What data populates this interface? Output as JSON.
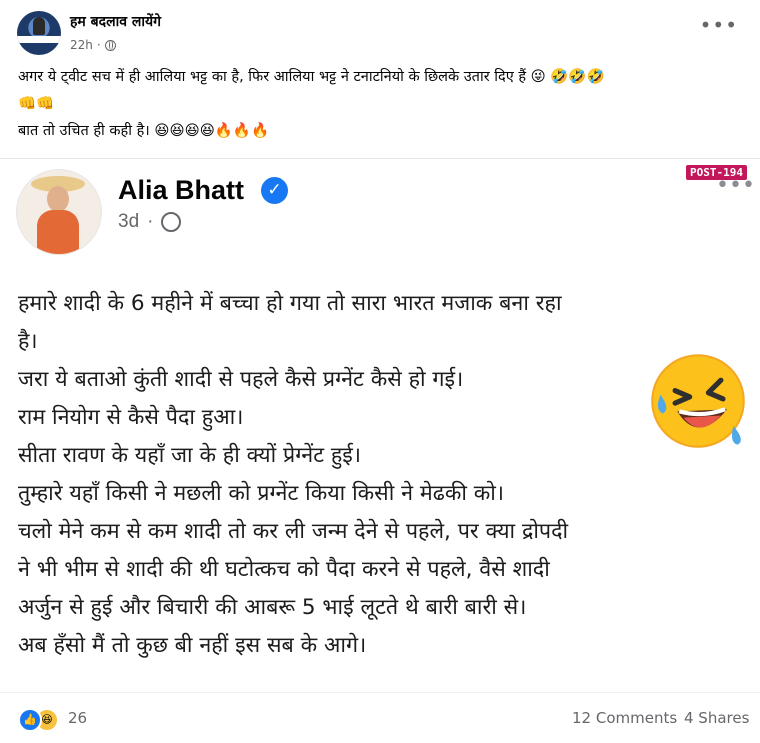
{
  "post": {
    "page_name": "हम बदलाव लायेंगे",
    "time": "22h",
    "caption_line1": "अगर ये ट्वीट सच में ही आलिया भट्ट का है, फिर आलिया भट्ट ने टनाटनियो के छिलके उतार दिए हैं  😜 🤣🤣🤣",
    "caption_line2": "👊👊",
    "caption_line3": "बात तो उचित ही कही है।  😆😆😆😆🔥🔥🔥"
  },
  "shared": {
    "author": "Alia Bhatt",
    "time": "3d",
    "badge": "POST-194",
    "lines": [
      "हमारे शादी के 6 महीने में बच्चा हो गया तो सारा भारत मजाक बना रहा",
      "है।",
      "जरा ये बताओ कुंती शादी से पहले कैसे प्रग्नेंट कैसे हो गई।",
      "राम नियोग से कैसे पैदा हुआ।",
      "सीता रावण के यहाँ जा के ही क्यों प्रेग्नेंट हुई।",
      "तुम्हारे यहाँ किसी ने मछली को प्रग्नेंट किया किसी ने मेढकी को।",
      "चलो मेने कम से कम शादी तो कर ली जन्म देने से पहले, पर क्या द्रोपदी",
      "ने भी भीम से शादी की थी घटोत्कच को पैदा करने से पहले, वैसे शादी",
      "अर्जुन से हुई और बिचारी की आबरू 5 भाई लूटते थे बारी बारी से।",
      "अब हँसो मैं तो कुछ बी नहीं इस सब के आगे।"
    ]
  },
  "footer": {
    "reaction_count": "26",
    "comments": "12 Comments",
    "shares": "4 Shares"
  },
  "colors": {
    "facebook_blue": "#1877f2",
    "badge": "#c2185b",
    "muted_text": "#65676b"
  },
  "icons": [
    "globe-icon",
    "more-icon",
    "verified-icon",
    "like-icon",
    "haha-icon",
    "laughing-emoji"
  ]
}
